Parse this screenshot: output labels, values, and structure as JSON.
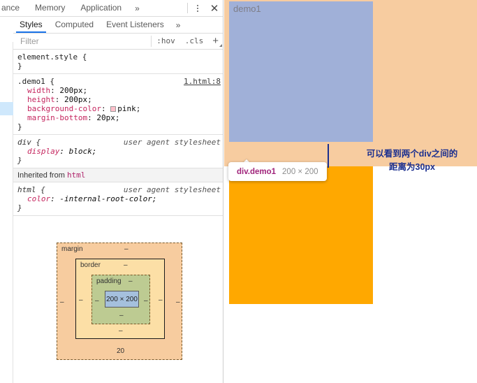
{
  "devtools": {
    "panel_tabs": [
      {
        "label": "ance",
        "name": "tab-performance-cut"
      },
      {
        "label": "Memory",
        "name": "tab-memory"
      },
      {
        "label": "Application",
        "name": "tab-application"
      }
    ],
    "more_tabs_icon": "»",
    "kebab_icon": "more-vertical-icon",
    "close_icon": "✕",
    "sidebar_tabs": [
      {
        "label": "Styles",
        "active": true
      },
      {
        "label": "Computed",
        "active": false
      },
      {
        "label": "Event Listeners",
        "active": false
      }
    ],
    "sidebar_more_icon": "»",
    "filter": {
      "placeholder": "Filter",
      "value": "",
      "hov_label": ":hov",
      "cls_label": ".cls",
      "plus_label": "+"
    },
    "rules": [
      {
        "selector": "element.style {",
        "close": "}",
        "origin": "",
        "declarations": []
      },
      {
        "selector": ".demo1 {",
        "close": "}",
        "origin": "1.html:8",
        "declarations": [
          {
            "prop": "width",
            "value": "200px",
            "swatch": null
          },
          {
            "prop": "height",
            "value": "200px",
            "swatch": null
          },
          {
            "prop": "background-color",
            "value": "pink",
            "swatch": "#ffc0cb"
          },
          {
            "prop": "margin-bottom",
            "value": "20px",
            "swatch": null
          }
        ]
      },
      {
        "selector": "div {",
        "close": "}",
        "origin": "user agent stylesheet",
        "declarations": [
          {
            "prop": "display",
            "value": "block",
            "swatch": null
          }
        ]
      }
    ],
    "inherited_label": "Inherited from",
    "inherited_from": "html",
    "inherited_rule": {
      "selector": "html {",
      "close": "}",
      "origin": "user agent stylesheet",
      "declarations": [
        {
          "prop": "color",
          "value": "-internal-root-color",
          "swatch": null
        }
      ]
    },
    "box_model": {
      "margin_label": "margin",
      "border_label": "border",
      "padding_label": "padding",
      "content_label": "200 × 200",
      "margin_top": "–",
      "margin_right": "–",
      "margin_bottom": "20",
      "margin_left": "–",
      "border_top": "–",
      "border_right": "–",
      "border_bottom": "–",
      "border_left": "–",
      "padding_top": "–",
      "padding_right": "–",
      "padding_bottom": "–",
      "padding_left": "–"
    }
  },
  "viewport": {
    "demo1_text": "demo1",
    "tooltip": {
      "selector": "div.demo1",
      "dimensions": "200 × 200"
    },
    "annotation": {
      "line1": "可以看到两个div之间的",
      "line2": "距离为30px"
    },
    "colors": {
      "demo1_fill": "#a0b0d8",
      "demo2_fill": "#ffa800",
      "margin_highlight": "#f7cca0",
      "annotation": "#1b2f8f"
    }
  }
}
